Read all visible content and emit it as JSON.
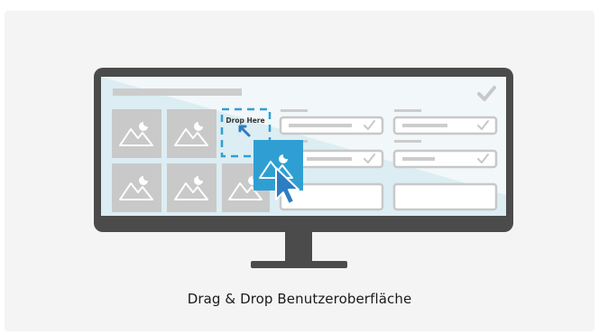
{
  "drop_zone": {
    "label": "Drop Here"
  },
  "caption": "Drag & Drop Benutzeroberfläche",
  "colors": {
    "monitor_frame": "#4b4b4b",
    "screen_bg": "#f2f7f9",
    "screen_tint": "#dcedf3",
    "placeholder": "#c9c9c9",
    "accent": "#2f9fd3",
    "cursor": "#2d7dc3",
    "field_border": "#c8c8c8"
  },
  "icons": [
    "image-icon",
    "check-icon",
    "arrow-up-left-icon",
    "cursor-icon"
  ]
}
